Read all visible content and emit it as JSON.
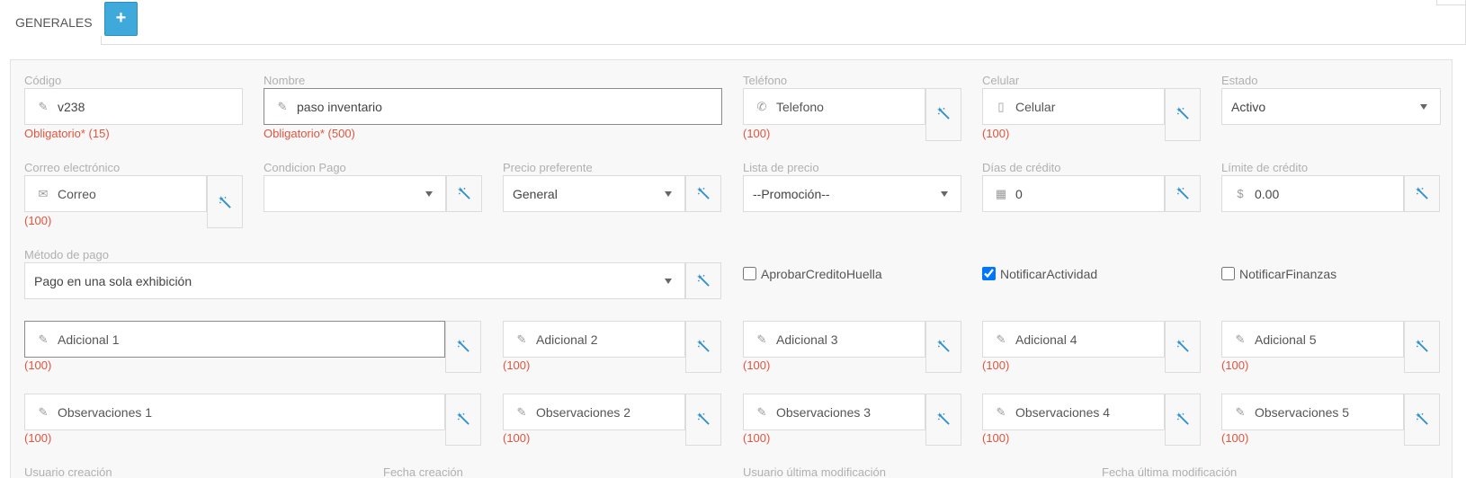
{
  "tabs": {
    "active": "GENERALES",
    "add_label": "+"
  },
  "fields": {
    "codigo": {
      "label": "Código",
      "value": "v238",
      "hint": "Obligatorio* (15)"
    },
    "nombre": {
      "label": "Nombre",
      "value": "paso inventario",
      "hint": "Obligatorio* (500)"
    },
    "telefono": {
      "label": "Teléfono",
      "placeholder": "Telefono",
      "hint": "(100)"
    },
    "celular": {
      "label": "Celular",
      "placeholder": "Celular",
      "hint": "(100)"
    },
    "estado": {
      "label": "Estado",
      "value": "Activo"
    },
    "correo": {
      "label": "Correo electrónico",
      "placeholder": "Correo",
      "hint": "(100)"
    },
    "condicion_pago": {
      "label": "Condicion Pago",
      "value": ""
    },
    "precio_preferente": {
      "label": "Precio preferente",
      "value": "General"
    },
    "lista_precio": {
      "label": "Lista de precio",
      "value": "--Promoción--"
    },
    "dias_credito": {
      "label": "Días de crédito",
      "value": "0"
    },
    "limite_credito": {
      "label": "Límite de crédito",
      "value": "0.00",
      "prefix": "$"
    },
    "metodo_pago": {
      "label": "Método de pago",
      "value": "Pago en una sola exhibición"
    },
    "adicionales": [
      {
        "placeholder": "Adicional 1",
        "hint": "(100)"
      },
      {
        "placeholder": "Adicional 2",
        "hint": "(100)"
      },
      {
        "placeholder": "Adicional 3",
        "hint": "(100)"
      },
      {
        "placeholder": "Adicional 4",
        "hint": "(100)"
      },
      {
        "placeholder": "Adicional 5",
        "hint": "(100)"
      }
    ],
    "observaciones": [
      {
        "placeholder": "Observaciones 1",
        "hint": "(100)"
      },
      {
        "placeholder": "Observaciones 2",
        "hint": "(100)"
      },
      {
        "placeholder": "Observaciones 3",
        "hint": "(100)"
      },
      {
        "placeholder": "Observaciones 4",
        "hint": "(100)"
      },
      {
        "placeholder": "Observaciones 5",
        "hint": "(100)"
      }
    ]
  },
  "checkboxes": [
    {
      "label": "AprobarCreditoHuella",
      "checked": false
    },
    {
      "label": "NotificarActividad",
      "checked": true
    },
    {
      "label": "NotificarFinanzas",
      "checked": false
    }
  ],
  "footer_labels": {
    "usuario_creacion": "Usuario creación",
    "fecha_creacion": "Fecha creación",
    "usuario_modificacion": "Usuario última modificación",
    "fecha_modificacion": "Fecha última modificación"
  },
  "icons": {
    "edit": "edit-icon",
    "phone": "phone-icon",
    "mobile": "mobile-icon",
    "envelope": "envelope-icon",
    "calendar": "calendar-icon",
    "dollar": "dollar-icon",
    "wand": "magic-wand-icon"
  },
  "colors": {
    "accent": "#3fa9db",
    "required": "#e2543d",
    "wand": "#2f8fd0"
  }
}
